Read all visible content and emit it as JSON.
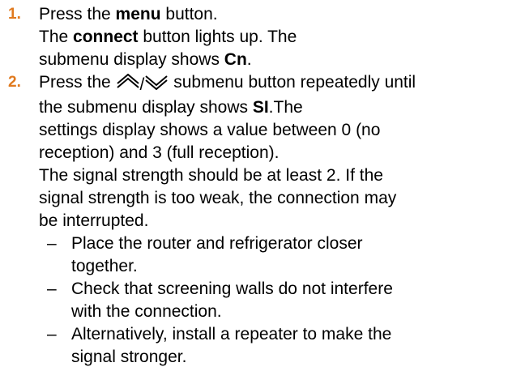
{
  "colors": {
    "accent": "#e07a1f",
    "text": "#000000"
  },
  "step1": {
    "number": "1.",
    "l1_pre": "Press the ",
    "l1_bold": "menu",
    "l1_post": " button.",
    "l2_pre": "The ",
    "l2_bold": "connect",
    "l2_post": " button lights up. The",
    "l3_pre": "submenu display shows ",
    "l3_bold": "Cn",
    "l3_post": "."
  },
  "step2": {
    "number": "2.",
    "l1_pre": "Press the ",
    "arrow_up_icon": "double-chevron-up-icon",
    "slash": "/",
    "arrow_down_icon": "double-chevron-down-icon",
    "l1_post": " submenu button repeatedly until",
    "l2_pre": "the submenu display shows ",
    "l2_bold": "SI",
    "l2_post": ".The",
    "l3": "settings display shows a value between 0 (no",
    "l4": "reception) and 3 (full reception).",
    "p2_l1": "The signal strength should be at least 2. If the",
    "p2_l2": "signal strength is too weak, the connection may",
    "p2_l3": "be interrupted.",
    "subitems": [
      {
        "dash": "–",
        "l1": "Place the router and refrigerator closer",
        "l2": "together."
      },
      {
        "dash": "–",
        "l1": "Check that screening walls do not interfere",
        "l2": "with the connection."
      },
      {
        "dash": "–",
        "l1": "Alternatively, install a repeater to make the",
        "l2": "signal stronger."
      }
    ]
  }
}
